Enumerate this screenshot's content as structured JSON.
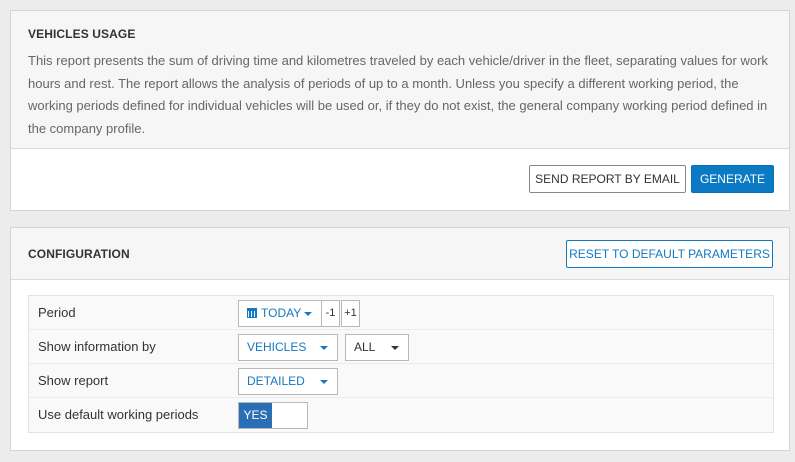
{
  "report": {
    "title": "VEHICLES USAGE",
    "description": "This report presents the sum of driving time and kilometres traveled by each vehicle/driver in the fleet, separating values for work hours and rest. The report allows the analysis of periods of up to a month. Unless you specify a different working period, the working periods defined for individual vehicles will be used or, if they do not exist, the general company working period defined in the company profile.",
    "send_email_label": "SEND REPORT BY EMAIL",
    "generate_label": "GENERATE"
  },
  "config": {
    "title": "CONFIGURATION",
    "reset_label": "RESET TO DEFAULT PARAMETERS",
    "rows": [
      {
        "label": "Period",
        "value": "TODAY",
        "prev": "-1",
        "next": "+1"
      },
      {
        "label": "Show information by",
        "value": "VEHICLES",
        "filter": "ALL"
      },
      {
        "label": "Show report",
        "value": "DETAILED"
      },
      {
        "label": "Use default working periods",
        "value": "YES"
      }
    ]
  },
  "colors": {
    "primary": "#0a7ac4",
    "link": "#1579bf",
    "toggle_on": "#2a6fb5"
  }
}
